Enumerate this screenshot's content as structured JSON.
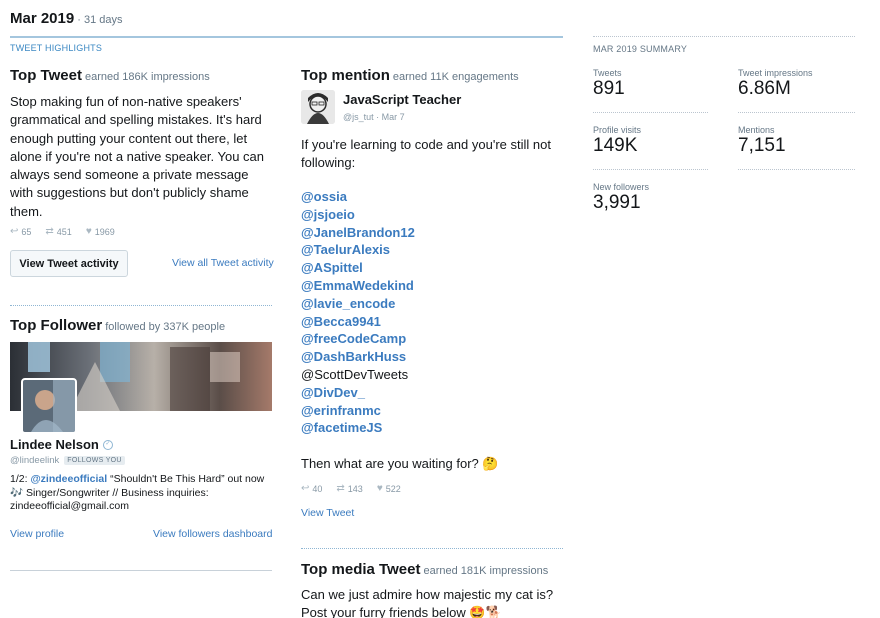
{
  "header": {
    "month": "Mar 2019",
    "days": " · 31 days"
  },
  "highlights_label": "TWEET HIGHLIGHTS",
  "top_tweet": {
    "title": "Top Tweet",
    "earned": "earned 186K impressions",
    "text": "Stop making fun of non-native speakers' grammatical and spelling mistakes. It's hard enough putting your content out there, let alone if you're not a native speaker. You can always send someone a private message with suggestions but don't publicly shame them.",
    "replies": "65",
    "retweets": "451",
    "likes": "1969",
    "activity_button": "View Tweet activity",
    "all_activity_link": "View all Tweet activity"
  },
  "top_follower": {
    "title": "Top Follower",
    "followed_by": "followed by 337K people",
    "name": "Lindee Nelson",
    "handle": "@lindeelink",
    "follows_you": "FOLLOWS YOU",
    "bio_prefix": "1/2: ",
    "bio_mention": "@zindeeofficial",
    "bio_rest": " “Shouldn't Be This Hard” out now 🎶 Singer/Songwriter // Business inquiries: zindeeofficial@gmail.com",
    "view_profile": "View profile",
    "view_dashboard": "View followers dashboard"
  },
  "top_mention": {
    "title": "Top mention",
    "earned": "earned 11K engagements",
    "author_name": "JavaScript Teacher",
    "author_handle": "@js_tut · Mar 7",
    "intro": "If you're learning to code and you're still not following:",
    "mentions": [
      {
        "text": "@ossia",
        "link": true
      },
      {
        "text": "@jsjoeio",
        "link": true
      },
      {
        "text": "@JanelBrandon12",
        "link": true
      },
      {
        "text": "@TaelurAlexis",
        "link": true
      },
      {
        "text": "@ASpittel",
        "link": true
      },
      {
        "text": "@EmmaWedekind",
        "link": true
      },
      {
        "text": "@lavie_encode",
        "link": true
      },
      {
        "text": "@Becca9941",
        "link": true
      },
      {
        "text": "@freeCodeCamp",
        "link": true
      },
      {
        "text": "@DashBarkHuss",
        "link": true
      },
      {
        "text": "@ScottDevTweets",
        "link": false
      },
      {
        "text": "@DivDev_",
        "link": true
      },
      {
        "text": "@erinfranmc",
        "link": true
      },
      {
        "text": "@facetimeJS",
        "link": true
      }
    ],
    "outro": "Then what are you waiting for? 🤔",
    "replies": "40",
    "retweets": "143",
    "likes": "522",
    "view_tweet": "View Tweet"
  },
  "top_media": {
    "title": "Top media Tweet",
    "earned": "earned 181K impressions",
    "text": "Can we just admire how majestic my cat is? Post your furry friends below 🤩🐕"
  },
  "summary": {
    "label": "MAR 2019 SUMMARY",
    "tweets_label": "Tweets",
    "tweets_value": "891",
    "impressions_label": "Tweet impressions",
    "impressions_value": "6.86M",
    "visits_label": "Profile visits",
    "visits_value": "149K",
    "mentions_label": "Mentions",
    "mentions_value": "7,151",
    "followers_label": "New followers",
    "followers_value": "3,991"
  },
  "icons": {
    "reply": "reply-icon",
    "retweet": "retweet-icon",
    "like": "heart-icon",
    "verified": "verified-icon"
  },
  "colors": {
    "link": "#3b7bbf",
    "accent_rule": "#a4c6de"
  }
}
